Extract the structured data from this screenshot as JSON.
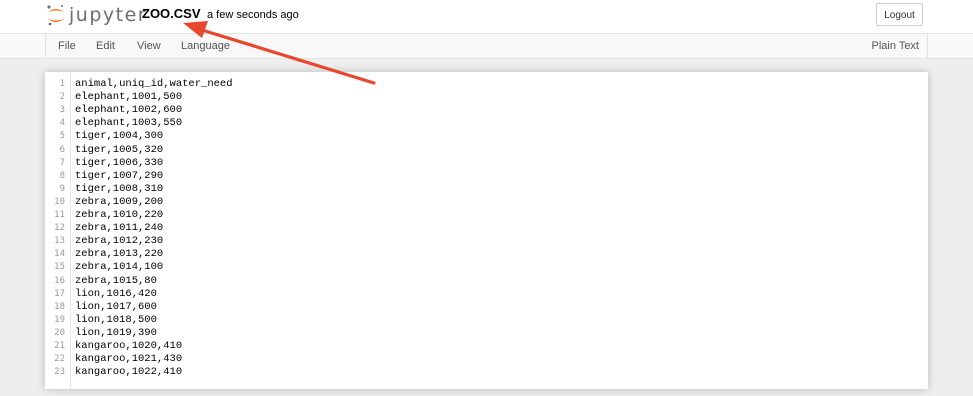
{
  "header": {
    "logo_text": "jupyter",
    "filename": "ZOO.CSV",
    "save_status": "a few seconds ago",
    "logout_label": "Logout"
  },
  "menu": {
    "items": [
      "File",
      "Edit",
      "View",
      "Language"
    ],
    "mode": "Plain Text"
  },
  "editor": {
    "lines": [
      {
        "n": "1",
        "text": "animal,uniq_id,water_need"
      },
      {
        "n": "2",
        "text": "elephant,1001,500"
      },
      {
        "n": "3",
        "text": "elephant,1002,600"
      },
      {
        "n": "4",
        "text": "elephant,1003,550"
      },
      {
        "n": "5",
        "text": "tiger,1004,300"
      },
      {
        "n": "6",
        "text": "tiger,1005,320"
      },
      {
        "n": "7",
        "text": "tiger,1006,330"
      },
      {
        "n": "8",
        "text": "tiger,1007,290"
      },
      {
        "n": "9",
        "text": "tiger,1008,310"
      },
      {
        "n": "10",
        "text": "zebra,1009,200"
      },
      {
        "n": "11",
        "text": "zebra,1010,220"
      },
      {
        "n": "12",
        "text": "zebra,1011,240"
      },
      {
        "n": "13",
        "text": "zebra,1012,230"
      },
      {
        "n": "14",
        "text": "zebra,1013,220"
      },
      {
        "n": "15",
        "text": "zebra,1014,100"
      },
      {
        "n": "16",
        "text": "zebra,1015,80"
      },
      {
        "n": "17",
        "text": "lion,1016,420"
      },
      {
        "n": "18",
        "text": "lion,1017,600"
      },
      {
        "n": "19",
        "text": "lion,1018,500"
      },
      {
        "n": "20",
        "text": "lion,1019,390"
      },
      {
        "n": "21",
        "text": "kangaroo,1020,410"
      },
      {
        "n": "22",
        "text": "kangaroo,1021,430"
      },
      {
        "n": "23",
        "text": "kangaroo,1022,410"
      }
    ]
  },
  "colors": {
    "logo_orange": "#f37726",
    "logo_grey": "#767677",
    "arrow": "#e8472d"
  },
  "icons": {
    "logo": "jupyter-logo-icon",
    "annotation": "annotation-arrow-icon"
  }
}
